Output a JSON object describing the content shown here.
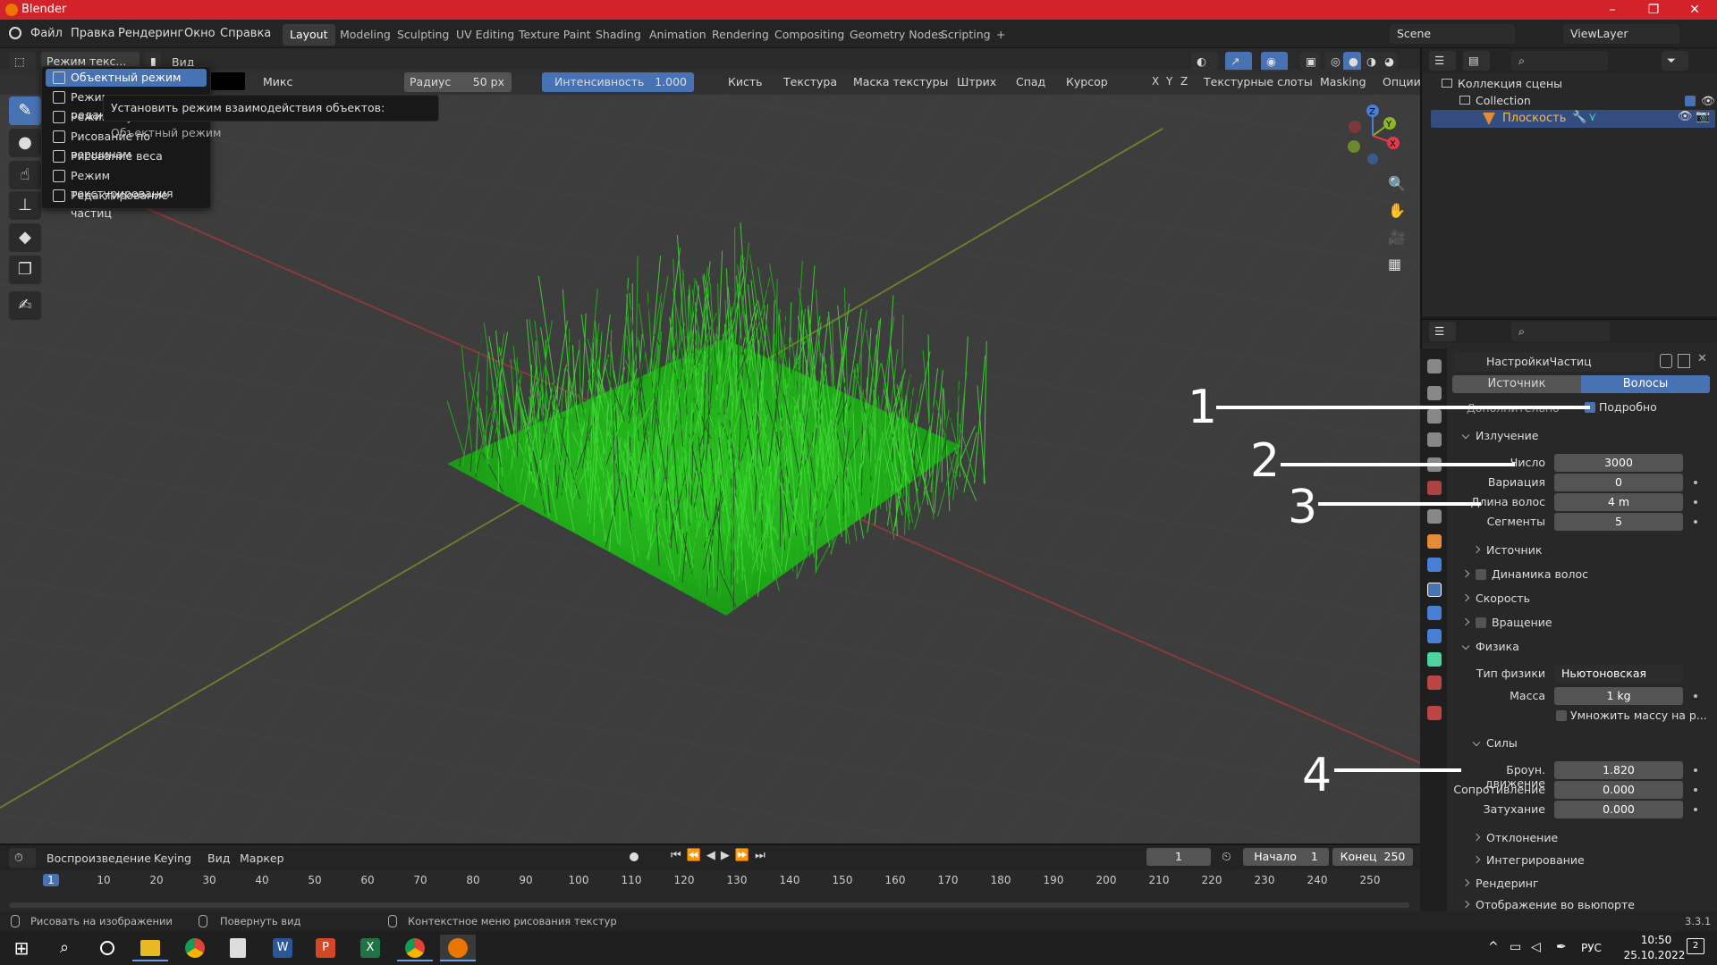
{
  "window": {
    "title": "Blender",
    "minimize": "–",
    "restore": "❐",
    "close": "✕"
  },
  "menu": [
    "Файл",
    "Правка",
    "Рендеринг",
    "Окно",
    "Справка"
  ],
  "workspaces": [
    "Layout",
    "Modeling",
    "Sculpting",
    "UV Editing",
    "Texture Paint",
    "Shading",
    "Animation",
    "Rendering",
    "Compositing",
    "Geometry Nodes",
    "Scripting"
  ],
  "active_workspace": "Layout",
  "add_tab": "+",
  "scene": "Scene",
  "view_layer": "ViewLayer",
  "viewport_header": {
    "mode": "Режим текс...",
    "view": "Вид",
    "blend": "Микс",
    "radius_label": "Радиус",
    "radius_value": "50 px",
    "strength_label": "Интенсивность",
    "strength_value": "1.000",
    "brush": "Кисть",
    "texture": "Текстура",
    "texture_mask": "Маска текстуры",
    "stroke": "Штрих",
    "falloff": "Спад",
    "cursor": "Курсор",
    "axes": [
      "X",
      "Y",
      "Z"
    ],
    "texture_slots": "Текстурные слоты",
    "masking": "Masking",
    "options": "Опции"
  },
  "mode_menu": {
    "items": [
      "Объектный режим",
      "Режим редактирования",
      "Режим скульптинга",
      "Рисование по вершинам",
      "Рисование веса",
      "Режим текстурирования",
      "Редактирование частиц"
    ],
    "selected_index": 0
  },
  "tooltip": {
    "text": "Установить режим взаимодействия объектов:",
    "value": "Объектный режим"
  },
  "gizmo": {
    "x": "X",
    "y": "Y",
    "z": "Z"
  },
  "outliner": {
    "scene_collection": "Коллекция сцены",
    "collection": "Collection",
    "object": "Плоскость"
  },
  "properties": {
    "datablock": "НастройкиЧастиц",
    "tabs": [
      "Источник",
      "Волосы"
    ],
    "active_tab": "Волосы",
    "advanced_checkbox_left": "Дополнительно",
    "advanced_checkbox": "Подробно",
    "emission": {
      "title": "Излучение",
      "rows": [
        {
          "label": "Число",
          "value": "3000"
        },
        {
          "label": "Вариация",
          "value": "0"
        },
        {
          "label": "Длина волос",
          "value": "4 m"
        },
        {
          "label": "Сегменты",
          "value": "5"
        }
      ],
      "sub": "Источник"
    },
    "sections_collapsed": [
      "Динамика волос",
      "Скорость",
      "Вращение"
    ],
    "physics": {
      "title": "Физика",
      "type_label": "Тип физики",
      "type_value": "Ньютоновская",
      "mass_label": "Масса",
      "mass_value": "1 kg",
      "multiply_mass": "Умножить массу на р..."
    },
    "forces": {
      "title": "Силы",
      "rows": [
        {
          "label": "Броун. движение",
          "value": "1.820"
        },
        {
          "label": "Сопротивление",
          "value": "0.000"
        },
        {
          "label": "Затухание",
          "value": "0.000"
        }
      ],
      "subs": [
        "Отклонение",
        "Интегрирование"
      ]
    },
    "bottom_sections": [
      "Рендеринг",
      "Отображение во вьюпорте"
    ]
  },
  "annotations": [
    "1",
    "2",
    "3",
    "4"
  ],
  "timeline": {
    "playback": "Воспроизведение",
    "keying": "Keying",
    "view": "Вид",
    "marker": "Маркер",
    "current_frame": "1",
    "start_label": "Начало",
    "start": "1",
    "end_label": "Конец",
    "end": "250",
    "ticks": [
      "1",
      "10",
      "20",
      "30",
      "40",
      "50",
      "60",
      "70",
      "80",
      "90",
      "100",
      "110",
      "120",
      "130",
      "140",
      "150",
      "160",
      "170",
      "180",
      "190",
      "200",
      "210",
      "220",
      "230",
      "240",
      "250"
    ]
  },
  "statusbar": {
    "left": "Рисовать на изображении",
    "mid": "Повернуть вид",
    "right": "Контекстное меню рисования текстур",
    "version": "3.3.1"
  },
  "taskbar": {
    "lang": "РУС",
    "time": "10:50",
    "date": "25.10.2022",
    "notifications": "2"
  },
  "colors": {
    "accent": "#4772b3",
    "title_bar": "#d2232a",
    "grass": "#22b01d",
    "grid_x": "#8a3a3a",
    "grid_y": "#6b7c2b"
  }
}
